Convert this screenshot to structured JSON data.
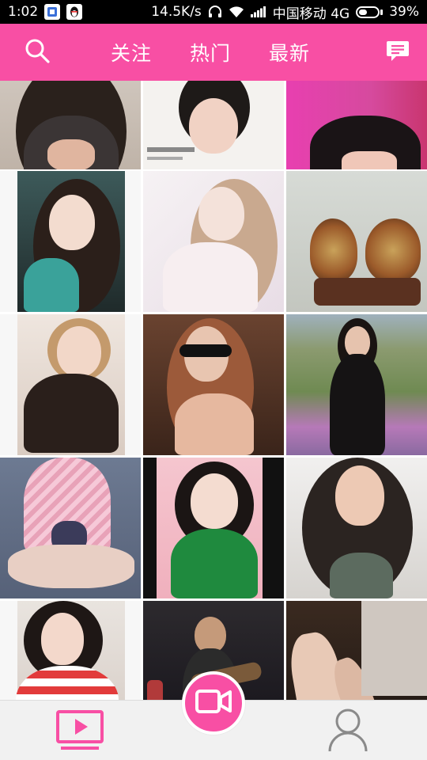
{
  "status_bar": {
    "time": "1:02",
    "app_icons": [
      "gallery-icon",
      "qq-penguin-icon"
    ],
    "net_speed": "14.5K/s",
    "carrier": "中国移动 4G",
    "battery": "39%",
    "battery_level": 0.39
  },
  "header": {
    "tabs": [
      {
        "label": "关注"
      },
      {
        "label": "热门"
      },
      {
        "label": "最新"
      }
    ],
    "left_icon": "search-icon",
    "right_icon": "message-icon",
    "accent": "#f84fa4"
  },
  "feed": {
    "tiles": [
      {
        "content": "woman-dark-top-lace"
      },
      {
        "content": "woman-cap-photo-caption"
      },
      {
        "content": "woman-black-top-pink-bg"
      },
      {
        "content": "woman-green-hoodie"
      },
      {
        "content": "woman-white-dress-soft"
      },
      {
        "content": "agate-stone-slices"
      },
      {
        "content": "woman-blonde-bob-black-top"
      },
      {
        "content": "woman-lace-mask"
      },
      {
        "content": "woman-black-dress-field"
      },
      {
        "content": "woman-striped-swimsuit"
      },
      {
        "content": "woman-green-dress-pink-room"
      },
      {
        "content": "woman-long-hair-portrait"
      },
      {
        "content": "woman-red-striped-shirt"
      },
      {
        "content": "man-guitar-stage"
      },
      {
        "content": "legs-dark-room"
      }
    ]
  },
  "bottom_nav": {
    "items": [
      {
        "icon": "tv-play-icon"
      },
      {
        "icon": "video-camera-icon"
      },
      {
        "icon": "person-icon"
      }
    ]
  }
}
